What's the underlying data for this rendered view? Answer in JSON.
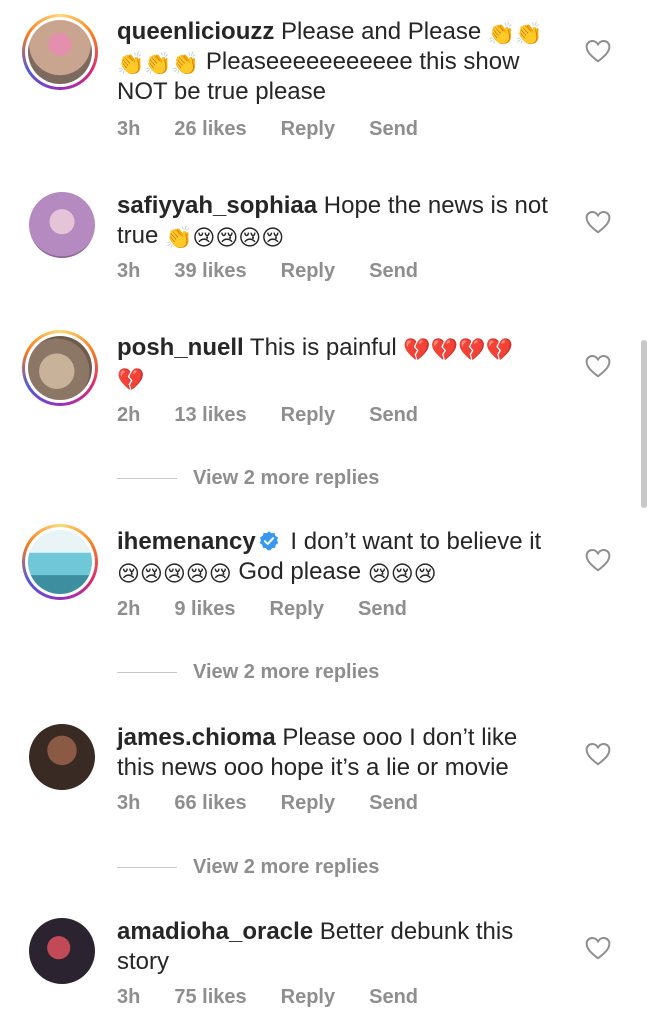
{
  "comments": [
    {
      "username": "queenliciouzz",
      "text_line1": "Please and Please",
      "text_line2": "Pleaseeeeeeeeeee this show",
      "text_line3": "NOT be true please",
      "emoji1": "👏👏",
      "emoji2": "👏👏👏",
      "time": "3h",
      "likes": "26 likes",
      "reply": "Reply",
      "send": "Send",
      "avatar_colors": [
        "#c9a48f",
        "#e58fae"
      ]
    },
    {
      "username": "safiyyah_sophiaa",
      "text_line1": "Hope the news is not",
      "text_line2": "true",
      "emoji1": "👏😢😢😢😢",
      "time": "3h",
      "likes": "39 likes",
      "reply": "Reply",
      "send": "Send",
      "avatar_colors": [
        "#b58ac0",
        "#e5c4d8"
      ]
    },
    {
      "username": "posh_nuell",
      "text_line1": "This is painful",
      "emoji1": "💔💔💔💔",
      "emoji2": "💔",
      "time": "2h",
      "likes": "13 likes",
      "reply": "Reply",
      "send": "Send",
      "view_replies": "View 2 more replies",
      "avatar_colors": [
        "#c9b29a",
        "#6d5b4d"
      ]
    },
    {
      "username": "ihemenancy",
      "text_line1": "I don’t want to believe it",
      "text_line2": "God please",
      "emoji1": "😢😢😢😢😢",
      "emoji2": "😢😢😢",
      "time": "2h",
      "likes": "9 likes",
      "reply": "Reply",
      "send": "Send",
      "view_replies": "View 2 more replies",
      "avatar_colors": [
        "#6fc7d8",
        "#e9f4f7"
      ]
    },
    {
      "username": "james.chioma",
      "text_line1": "Please ooo I don’t like",
      "text_line2": "this news ooo hope it’s a lie or movie",
      "time": "3h",
      "likes": "66 likes",
      "reply": "Reply",
      "send": "Send",
      "view_replies": "View 2 more replies",
      "avatar_colors": [
        "#3a2a24",
        "#8a5a45"
      ]
    },
    {
      "username": "amadioha_oracle",
      "text_line1": "Better debunk this",
      "text_line2": "story",
      "time": "3h",
      "likes": "75 likes",
      "reply": "Reply",
      "send": "Send",
      "avatar_colors": [
        "#2b2430",
        "#c24a57"
      ]
    }
  ],
  "icons": {
    "heart": "heart-outline-icon",
    "verified": "verified-badge-icon"
  },
  "colors": {
    "muted": "#8e8e8e",
    "verified": "#3897f0"
  }
}
